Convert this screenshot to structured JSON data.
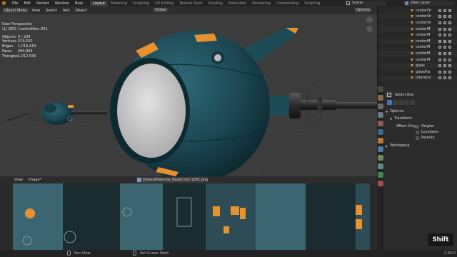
{
  "topbar": {
    "menus": [
      "File",
      "Edit",
      "Render",
      "Window",
      "Help"
    ],
    "workspace_tabs": [
      "Layout",
      "Modeling",
      "Sculpting",
      "UV Editing",
      "Texture Paint",
      "Shading",
      "Animation",
      "Rendering",
      "Compositing",
      "Scripting"
    ],
    "active_tab": "Layout",
    "scene": "Scene",
    "view_layer": "View Layer"
  },
  "viewport": {
    "mode": "Object Mode",
    "menus": [
      "View",
      "Select",
      "Add",
      "Object"
    ],
    "orientation": "Global",
    "options": "Options",
    "overlay_title": "User Perspective",
    "overlay_object": "(1) GEO | centerMain.001",
    "stats": [
      {
        "label": "Objects",
        "value": "0 / 234"
      },
      {
        "label": "Vertices",
        "value": "519,532"
      },
      {
        "label": "Edges",
        "value": "1,016,419"
      },
      {
        "label": "Faces",
        "value": "499,964"
      },
      {
        "label": "Triangles",
        "value": "1,012,556"
      }
    ]
  },
  "image_editor": {
    "menus": [
      "View",
      "Image*"
    ],
    "image_name": "DefaultMaterial_BaseColor.1001.png"
  },
  "outliner": {
    "items": [
      "centerOr",
      "centerOr",
      "centerOr",
      "centerM",
      "centerM",
      "centerM",
      "centerM",
      "centerM",
      "centerM",
      "glass",
      "glassFra",
      "interiorV"
    ]
  },
  "properties": {
    "tool_name": "Select Box",
    "options_label": "Options",
    "transform_label": "Transform",
    "affect_only_label": "Affect Only",
    "checkboxes": [
      "Origins",
      "Locations",
      "Parents"
    ],
    "workspace_label": "Workspace"
  },
  "statusbar": {
    "pan_view": "Pan View",
    "set_cursor": "Set Cursor Point",
    "version": "2.90.0"
  },
  "key_overlay": "Shift",
  "colors": {
    "accent": "#4772b3",
    "orange": "#e8912f",
    "teal_body": "#1c4a55"
  }
}
